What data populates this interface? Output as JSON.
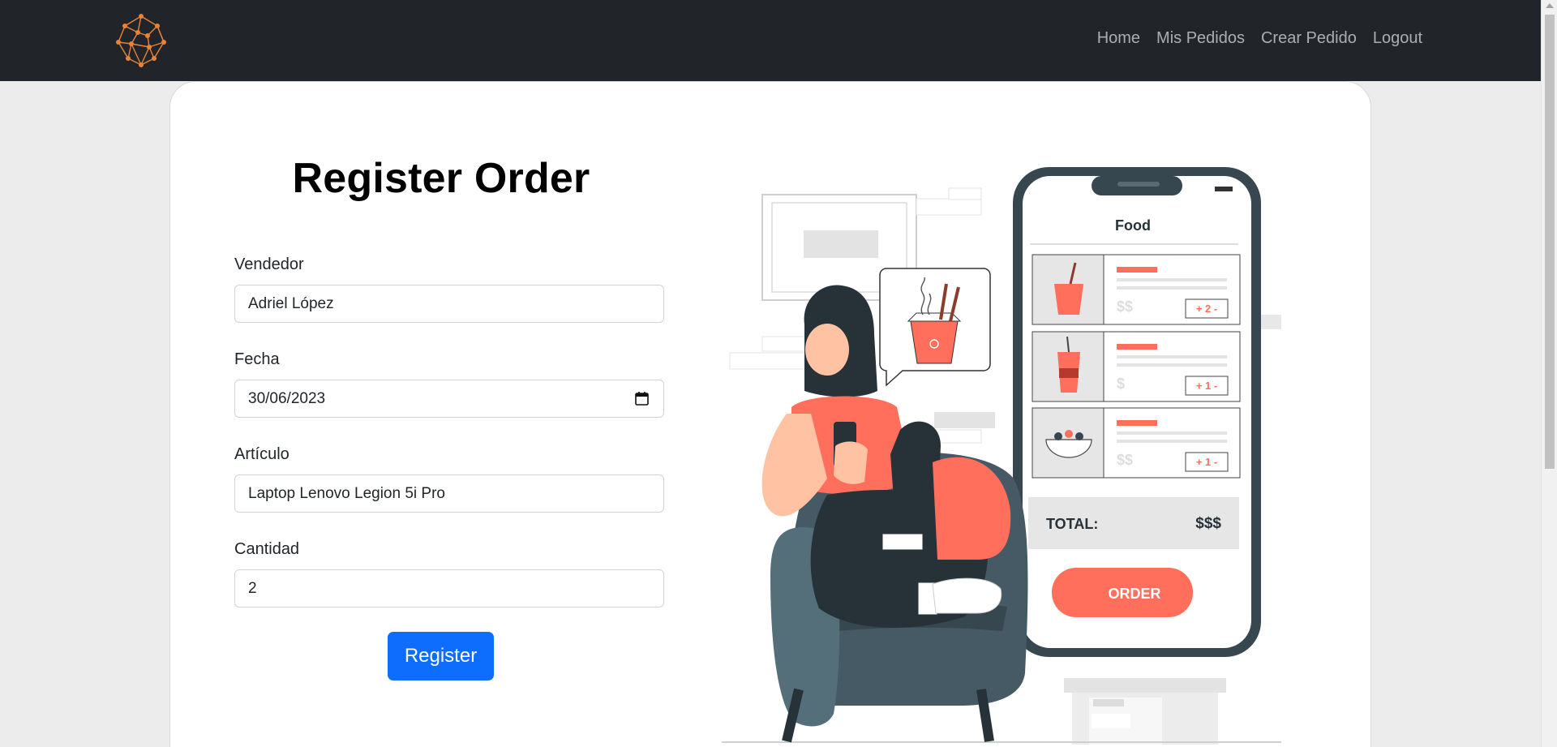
{
  "nav": {
    "logo": "network-logo",
    "links": [
      {
        "label": "Home"
      },
      {
        "label": "Mis Pedidos"
      },
      {
        "label": "Crear Pedido"
      },
      {
        "label": "Logout"
      }
    ]
  },
  "form": {
    "title": "Register Order",
    "vendedor": {
      "label": "Vendedor",
      "value": "Adriel López"
    },
    "fecha": {
      "label": "Fecha",
      "value": "30/06/2023"
    },
    "articulo": {
      "label": "Artículo",
      "value": "Laptop Lenovo Legion 5i Pro"
    },
    "cantidad": {
      "label": "Cantidad",
      "value": "2"
    },
    "submit_label": "Register"
  },
  "illustration": {
    "app_title": "Food",
    "items": [
      {
        "price": "$$",
        "qty": "+ 2 -"
      },
      {
        "price": "$",
        "qty": "+ 1 -"
      },
      {
        "price": "$$",
        "qty": "+ 1 -"
      }
    ],
    "total_label": "TOTAL:",
    "total_value": "$$$",
    "order_label": "ORDER"
  },
  "colors": {
    "navbar": "#212529",
    "primary": "#0d6efd",
    "accent": "#ff6f5b",
    "logo": "#e8833a"
  }
}
